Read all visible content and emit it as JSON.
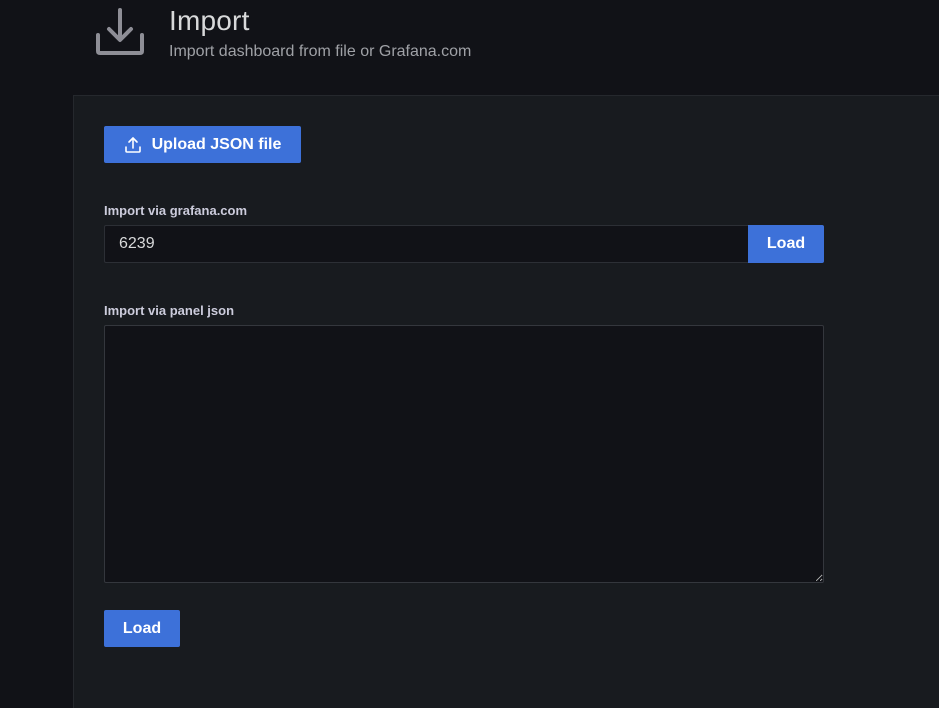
{
  "header": {
    "icon": "download-icon",
    "title": "Import",
    "subtitle": "Import dashboard from file or Grafana.com"
  },
  "upload": {
    "icon": "upload-icon",
    "label": "Upload JSON file"
  },
  "grafana_com": {
    "label": "Import via grafana.com",
    "value": "6239",
    "load_label": "Load"
  },
  "panel_json": {
    "label": "Import via panel json",
    "value": "",
    "load_label": "Load"
  },
  "colors": {
    "primary": "#3d71d9",
    "background": "#111217",
    "panel": "#181b1f",
    "text": "#d8d9da",
    "muted_text": "#9fa1a6"
  }
}
